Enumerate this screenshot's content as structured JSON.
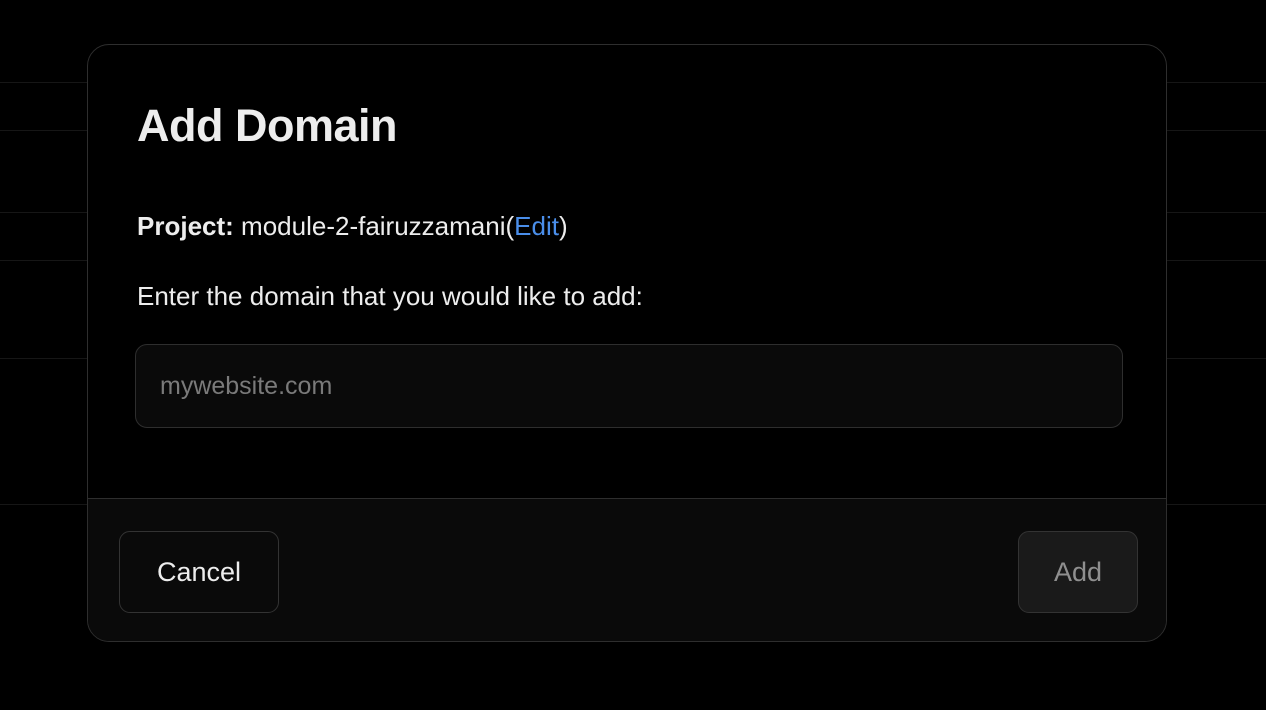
{
  "dialog": {
    "title": "Add Domain",
    "project_label": "Project:",
    "project_name": "module-2-fairuzzamani",
    "paren_open": "(",
    "edit_label": "Edit",
    "paren_close": ")",
    "instruction": "Enter the domain that you would like to add:",
    "domain_input": {
      "value": "",
      "placeholder": "mywebsite.com"
    },
    "cancel_label": "Cancel",
    "add_label": "Add"
  },
  "colors": {
    "background": "#000000",
    "text": "#ededed",
    "link": "#4a8eea",
    "placeholder": "#7a7a7a",
    "border": "#2e2e2e",
    "disabled_text": "#8f8f8f"
  }
}
